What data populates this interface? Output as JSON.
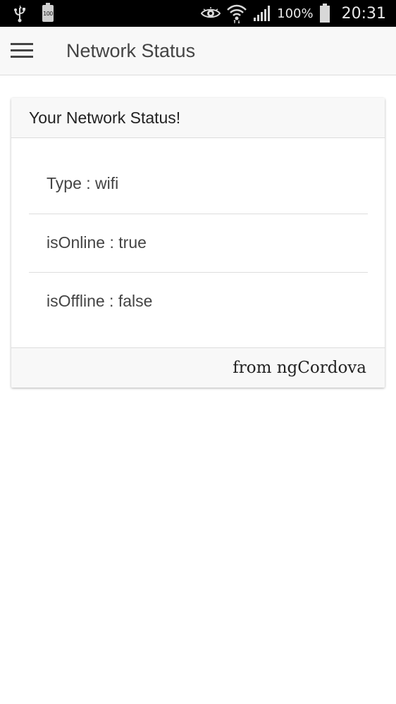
{
  "status_bar": {
    "icons": [
      "usb-icon",
      "battery-notification-icon",
      "eye-icon",
      "wifi-icon",
      "signal-icon",
      "battery-icon"
    ],
    "notification_battery_label": "100",
    "battery_percent": "100%",
    "time": "20:31"
  },
  "header": {
    "menu_icon": "hamburger-menu-icon",
    "title": "Network Status"
  },
  "card": {
    "header": "Your Network Status!",
    "items": [
      {
        "label": "Type",
        "separator": " : ",
        "value": "wifi",
        "text": "Type : wifi"
      },
      {
        "label": "isOnline",
        "separator": " : ",
        "value": "true",
        "text": "isOnline : true"
      },
      {
        "label": "isOffline",
        "separator": " : ",
        "value": "false",
        "text": "isOffline : false"
      }
    ],
    "footer": "from ngCordova"
  },
  "colors": {
    "status_bar_bg": "#000000",
    "header_bg": "#f8f8f8",
    "text": "#444444",
    "divider": "#dddddd",
    "page_bg": "#ffffff"
  }
}
